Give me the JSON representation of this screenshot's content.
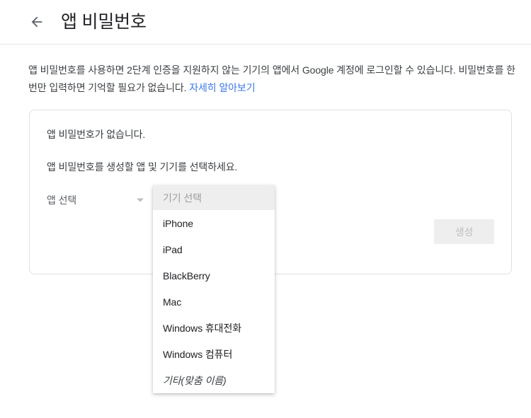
{
  "header": {
    "back_icon": "arrow-left-icon",
    "title": "앱 비밀번호"
  },
  "description": {
    "text": "앱 비밀번호를 사용하면 2단계 인증을 지원하지 않는 기기의 앱에서 Google 계정에 로그인할 수 있습니다. 비밀번호를 한 번만 입력하면 기억할 필요가 없습니다. ",
    "link_label": "자세히 알아보기",
    "link_color": "#3b78e7"
  },
  "card": {
    "empty_state_text": "앱 비밀번호가 없습니다.",
    "instruction_text": "앱 비밀번호를 생성할 앱 및 기기를 선택하세요.",
    "app_select": {
      "label": "앱 선택",
      "caret_icon": "chevron-down-icon"
    },
    "generate_button": {
      "label": "생성",
      "disabled": true,
      "background": "#eeeeee",
      "text_color": "#bdbdbd"
    }
  },
  "device_dropdown": {
    "header_label": "기기 선택",
    "header_background": "#eeeeee",
    "items": [
      {
        "label": "iPhone",
        "italic": false
      },
      {
        "label": "iPad",
        "italic": false
      },
      {
        "label": "BlackBerry",
        "italic": false
      },
      {
        "label": "Mac",
        "italic": false
      },
      {
        "label": "Windows 휴대전화",
        "italic": false
      },
      {
        "label": "Windows 컴퓨터",
        "italic": false
      },
      {
        "label": "기타(맞춤 이름)",
        "italic": true
      }
    ]
  }
}
